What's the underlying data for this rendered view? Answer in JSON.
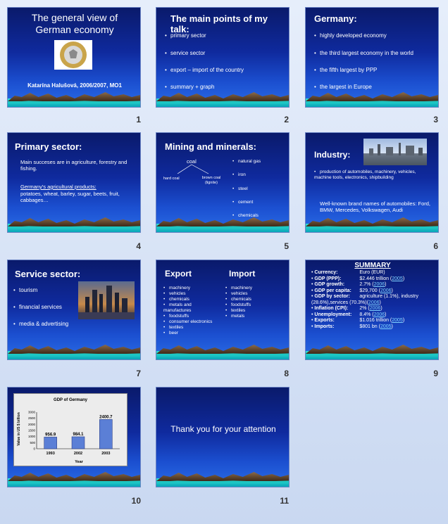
{
  "slides": [
    {
      "number": "1",
      "title": "The general view of German economy",
      "author": "Katarína Halušová, 2006/2007, MO1"
    },
    {
      "number": "2",
      "title": "The main points of my talk:",
      "bullets": [
        "primary sector",
        "service sector",
        "export – import of the country",
        "summary + graph"
      ]
    },
    {
      "number": "3",
      "title": "Germany:",
      "bullets": [
        "highly developed economy",
        "the third largest economy in the world",
        "the fifth largest by PPP",
        "the largest in Europe"
      ]
    },
    {
      "number": "4",
      "title": "Primary sector:",
      "text1": "Main succeses are in agriculture, forestry and fishing.",
      "text2": "Germany's agricultural products:",
      "text3": "potatoes, wheat, barley, sugar, beets, fruit, cabbages…"
    },
    {
      "number": "5",
      "title": "Mining and minerals:",
      "coal": "coal",
      "hard_coal": "hard coal",
      "brown_coal": "brown coal (lignite)",
      "bullets": [
        "natural gas",
        "iron",
        "steel",
        "cement",
        "chemicals"
      ]
    },
    {
      "number": "6",
      "title": "Industry:",
      "bullet": "production of automobiles, machinery, vehicles, machine tools, electronics, shipbuilding",
      "brands": "Well-known brand names of automobiles: Ford, BMW, Mercedes, Volkswagen, Audi"
    },
    {
      "number": "7",
      "title": "Service sector:",
      "bullets": [
        "tourism",
        "financial services",
        "media & advertising"
      ]
    },
    {
      "number": "8",
      "export_title": "Export",
      "import_title": "Import",
      "export": [
        "machinery",
        "vehicles",
        "chemicals",
        "metals and manufactures",
        "foodstuffs",
        "consumer electronics",
        "textiles",
        "beer"
      ],
      "import": [
        "machinery",
        "vehicles",
        "chemicals",
        "foodstuffs",
        "textiles",
        "metals"
      ]
    },
    {
      "number": "9",
      "title": "SUMMARY",
      "rows": [
        {
          "label": "Currency:",
          "value": "Euro (EUR)",
          "year": ""
        },
        {
          "label": "GDP (PPP):",
          "value": "$2.446 trillion (",
          "year": "2005"
        },
        {
          "label": "GDP growth:",
          "value": "2.7% (",
          "year": "2006"
        },
        {
          "label": "GDP per capita:",
          "value": "$29,700 (",
          "year": "2006"
        },
        {
          "label": "GDP by sector:",
          "value": "agriculture (1.1%), industry (28.6%),services (70.3%)(",
          "year": "2006"
        },
        {
          "label": "Inflation (CPI):",
          "value": "2% (",
          "year": "2006"
        },
        {
          "label": "Unemployment:",
          "value": "8.4% (",
          "year": "2006"
        },
        {
          "label": "Exports:",
          "value": "$1.016 trillion (",
          "year": "2005"
        },
        {
          "label": "Imports:",
          "value": "$801 bn (",
          "year": "2005"
        }
      ]
    },
    {
      "number": "10"
    },
    {
      "number": "11",
      "title": "Thank you for your attention"
    }
  ],
  "chart_data": {
    "type": "bar",
    "title": "GDP of Germany",
    "xlabel": "Year",
    "ylabel": "Value in US $ billion",
    "categories": [
      "1993",
      "2002",
      "2003"
    ],
    "values": [
      956.9,
      984.1,
      2400.7
    ],
    "value_labels": [
      "956.9",
      "984.1",
      "2400.7"
    ],
    "ylim": [
      0,
      3000
    ],
    "yticks": [
      "0",
      "500",
      "1000",
      "1500",
      "2000",
      "2500",
      "3000"
    ],
    "grid": false
  },
  "colors": {
    "slide_dark": "#0a1a6b",
    "slide_light": "#2a6ce6",
    "mountain": "#6b4a2f",
    "cyan": "#27d6c9",
    "link": "#7fd3ff"
  }
}
